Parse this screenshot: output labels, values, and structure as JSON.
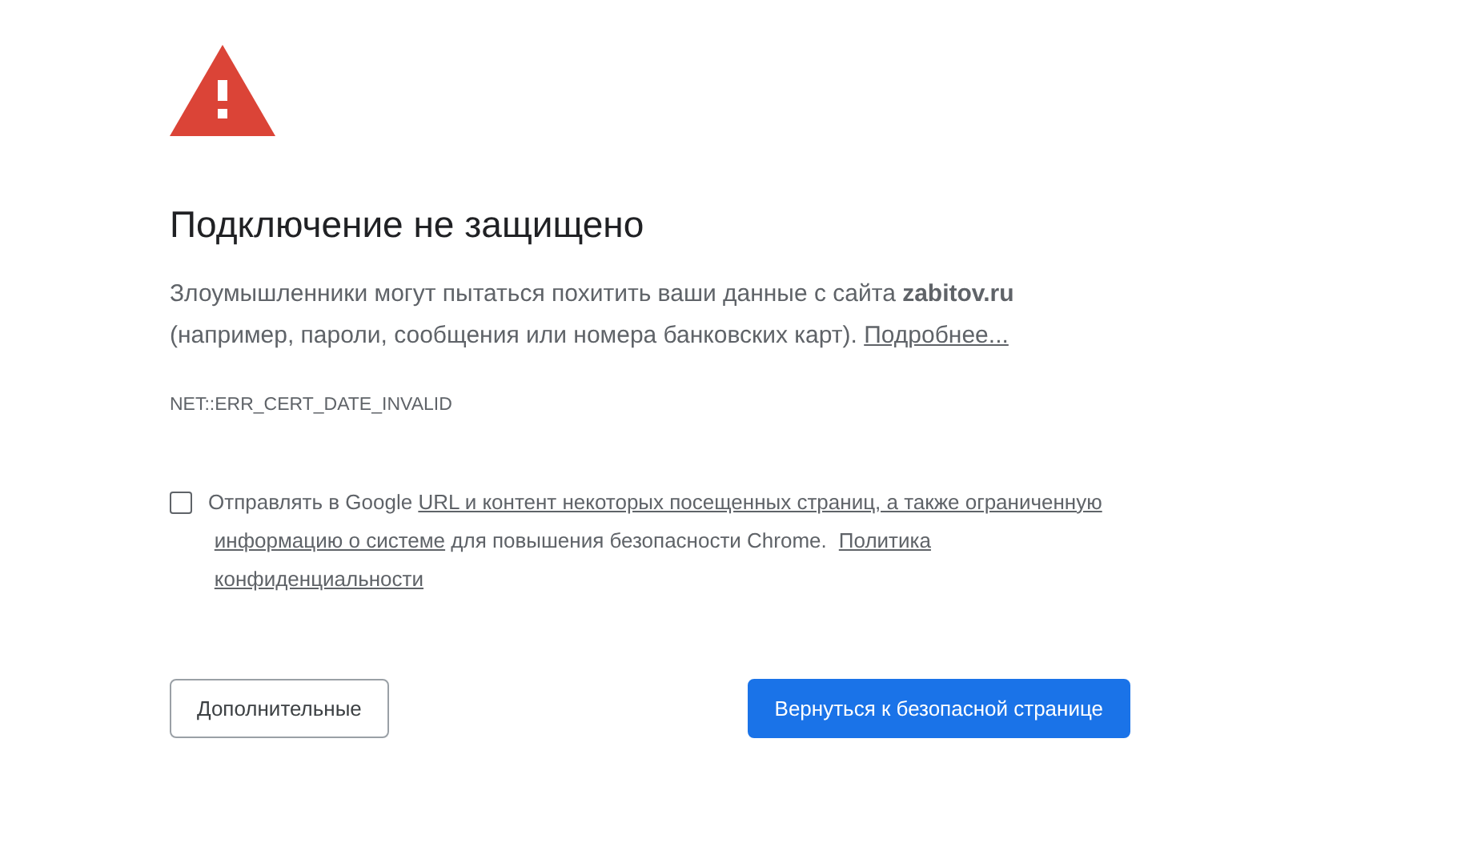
{
  "title": "Подключение не защищено",
  "message": [
    {
      "kind": "text",
      "text": "Злоумышленники могут пытаться похитить ваши данные с сайта "
    },
    {
      "kind": "bold",
      "text": "zabitov.ru"
    },
    {
      "kind": "text",
      "text": " (например, пароли, сообщения или номера банковских карт). "
    },
    {
      "kind": "link",
      "text": "Подробнее..."
    }
  ],
  "error_code": "NET::ERR_CERT_DATE_INVALID",
  "opt_in": {
    "checked": false,
    "parts": [
      {
        "kind": "text",
        "text": "Отправлять в Google "
      },
      {
        "kind": "link",
        "text": "URL и контент некоторых посещенных страниц, а также ограниченную"
      },
      {
        "kind": "link",
        "text": "информацию о системе"
      },
      {
        "kind": "text",
        "text": " для повышения безопасности Chrome. "
      },
      {
        "kind": "link",
        "text": "Политика"
      },
      {
        "kind": "link",
        "text": "конфиденциальности"
      }
    ]
  },
  "buttons": [
    {
      "kind": "secondary",
      "label": "Дополнительные"
    },
    {
      "kind": "primary",
      "label": "Вернуться к безопасной странице"
    }
  ]
}
